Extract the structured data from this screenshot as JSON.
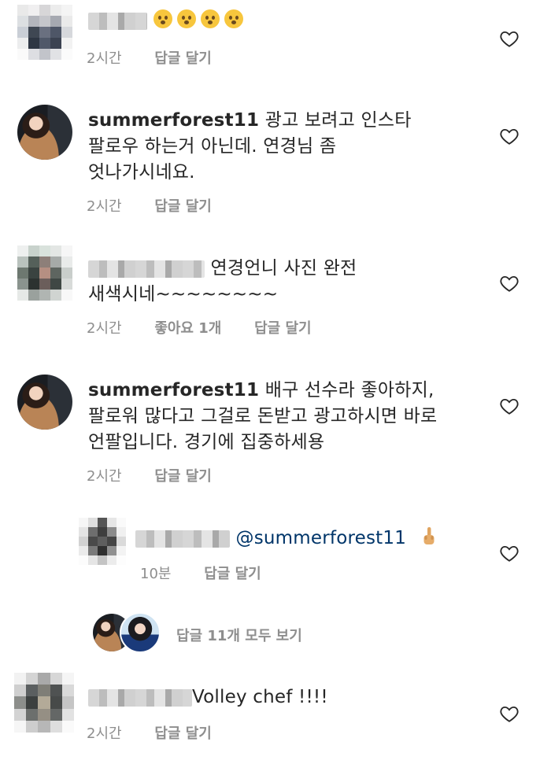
{
  "comments": [
    {
      "username": "",
      "text": "",
      "emoji_count": 4,
      "time": "2시간",
      "reply": "답글 달기",
      "likes": ""
    },
    {
      "username": "summerforest11",
      "text_l1": "광고 보려고 인스타",
      "text_l2": "팔로우 하는거 아닌데. 연경님 좀",
      "text_l3": "엇나가시네요.",
      "time": "2시간",
      "reply": "답글 달기"
    },
    {
      "username": "",
      "text_l1": "연경언니 사진 완전",
      "text_l2": "새색시네~~~~~~~~",
      "time": "2시간",
      "likes": "좋아요 1개",
      "reply": "답글 달기"
    },
    {
      "username": "summerforest11",
      "text_l1": "배구 선수라 좋아하지,",
      "text_l2": "팔로워 많다고 그걸로 돈받고 광고하시면 바로",
      "text_l3": "언팔입니다. 경기에 집중하세용",
      "time": "2시간",
      "reply": "답글 달기"
    },
    {
      "username": "",
      "mention": "@summerforest11",
      "time": "10분",
      "reply": "답글 달기"
    },
    {
      "username": "",
      "text": "Volley chef !!!!",
      "time": "2시간",
      "reply": "답글 달기"
    }
  ],
  "view_replies": "답글 11개 모두 보기",
  "icons": {
    "heart": "heart-outline-icon",
    "emoji": "hushed-face-emoji",
    "finger": "middle-finger-emoji"
  },
  "colors": {
    "text": "#262626",
    "meta": "#8e8e8e",
    "mention": "#003569"
  }
}
